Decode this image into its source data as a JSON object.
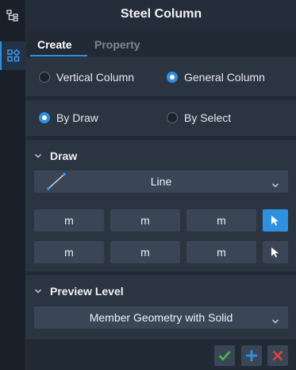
{
  "title": "Steel Column",
  "tabs": {
    "create": "Create",
    "property": "Property"
  },
  "column_type": {
    "options": [
      "Vertical Column",
      "General Column"
    ],
    "selected": "General Column"
  },
  "method": {
    "options": [
      "By Draw",
      "By Select"
    ],
    "selected": "By Draw"
  },
  "draw": {
    "header": "Draw",
    "shape": {
      "label": "Line",
      "icon": "line-draw-icon"
    },
    "row1": {
      "fields": [
        "m",
        "m",
        "m"
      ],
      "pick_icon": "cursor-pick-icon"
    },
    "row2": {
      "fields": [
        "m",
        "m",
        "m"
      ],
      "pick_icon": "cursor-pick-icon"
    }
  },
  "preview": {
    "header": "Preview Level",
    "selected": "Member Geometry with Solid"
  },
  "footer": {
    "icons": [
      "check-icon",
      "plus-icon",
      "close-icon"
    ]
  },
  "colors": {
    "accent": "#2f8fe0",
    "confirm": "#3fbf4a",
    "cancel": "#e0413a"
  }
}
